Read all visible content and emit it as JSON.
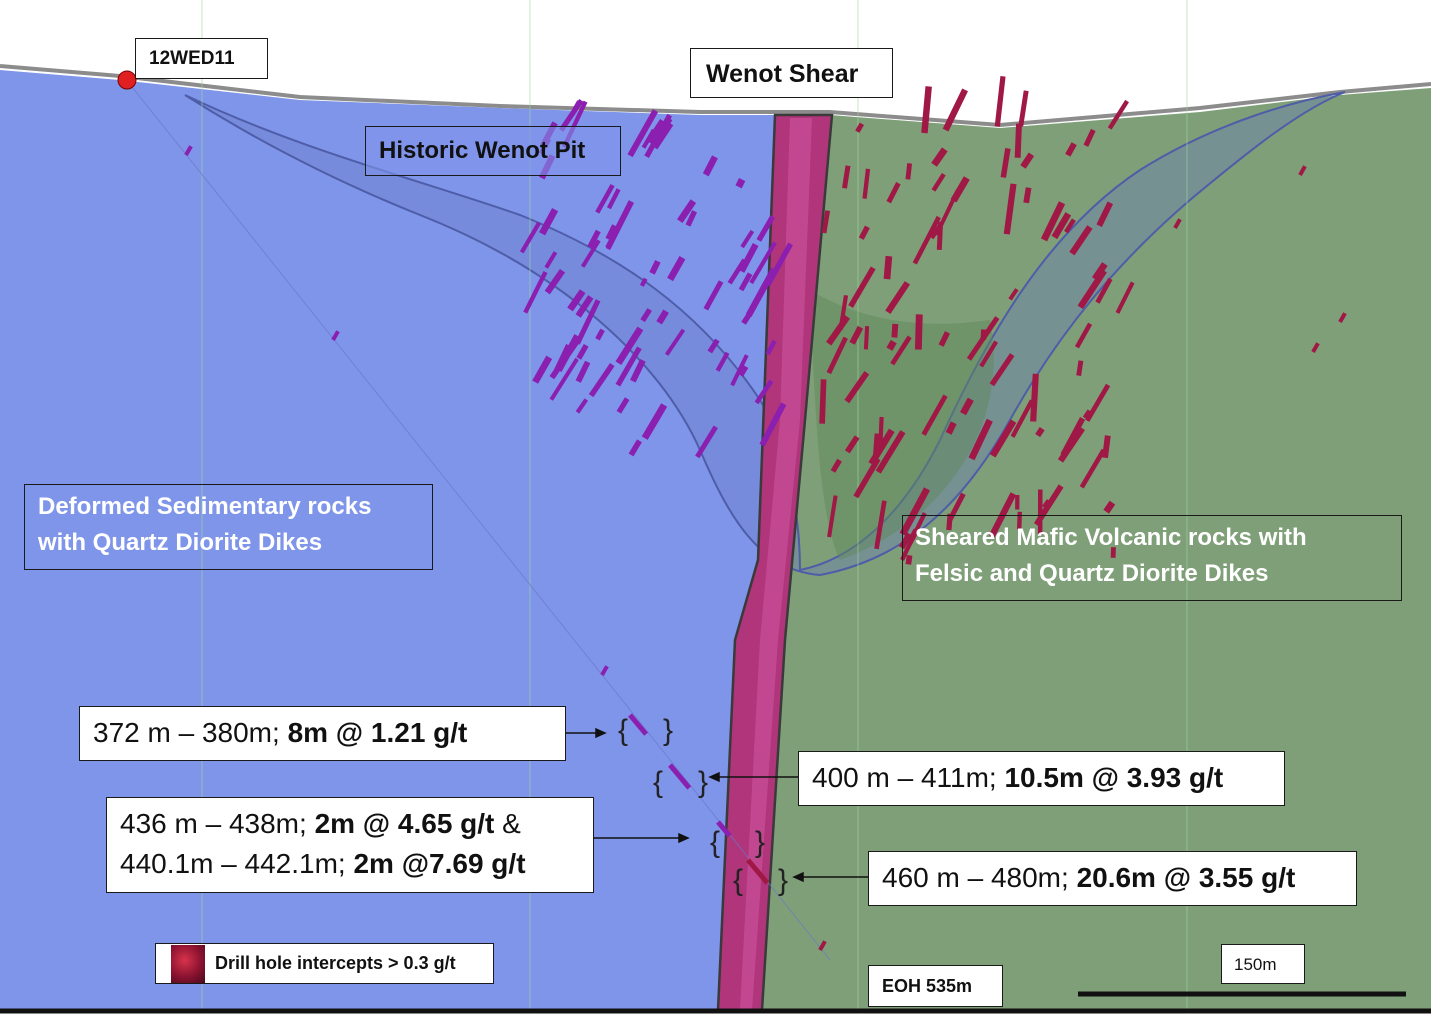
{
  "labels": {
    "hole": "12WED11",
    "shear": "Wenot Shear",
    "pit": "Historic Wenot Pit",
    "sedimentary": [
      "Deformed Sedimentary rocks",
      "with Quartz Diorite Dikes"
    ],
    "volcanic": [
      "Sheared Mafic Volcanic rocks with",
      "Felsic and Quartz Diorite  Dikes"
    ],
    "legend": "Drill hole intercepts > 0.3 g/t",
    "eoh": "EOH 535m",
    "scale": "150m"
  },
  "intercepts": [
    {
      "range": "372 m – 380m; ",
      "result": "8m @ 1.21 g/t"
    },
    {
      "range": "400 m – 411m; ",
      "result": "10.5m @ 3.93 g/t"
    },
    {
      "range": "436 m – 438m; ",
      "result": "2m @ 4.65 g/t",
      "suffix": " &"
    },
    {
      "range": "440.1m – 442.1m; ",
      "result": "2m @7.69 g/t"
    },
    {
      "range": "460 m – 480m; ",
      "result": "20.6m @ 3.55 g/t"
    }
  ],
  "colors": {
    "sedimentary_fill": "#7f95ea",
    "volcanic_fill": "#7f9f78",
    "shear_zone": "#b0357a",
    "pit_shell": "#5566b8",
    "intercept_purple": "#8a1fb0",
    "intercept_red": "#a01845",
    "collar": "#e02020"
  }
}
